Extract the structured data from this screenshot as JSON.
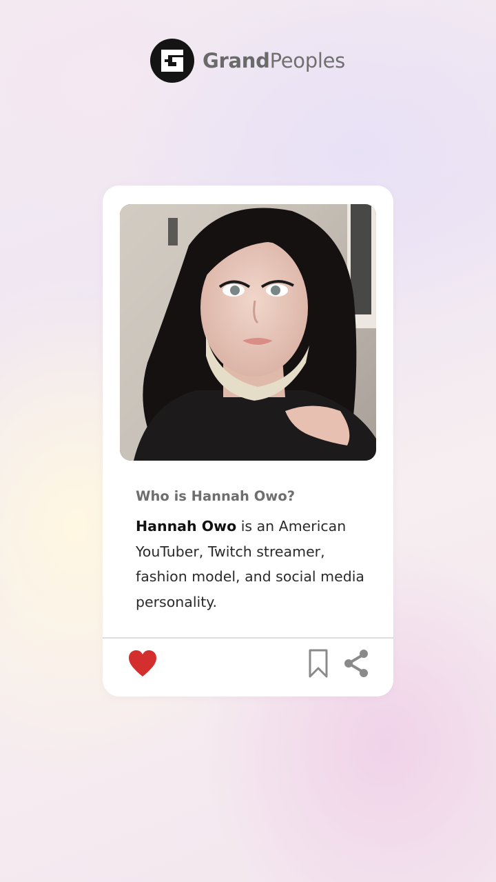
{
  "brand": {
    "name_bold": "Grand",
    "name_regular": "Peoples",
    "logo_icon": "grandpeoples-g-logo"
  },
  "post": {
    "image_alt": "Hannah Owo",
    "question": "Who is Hannah Owo?",
    "bio_name": "Hannah Owo",
    "bio_text": " is an American YouTuber, Twitch streamer, fashion model, and social media personality."
  },
  "actions": {
    "like_icon": "heart-icon",
    "save_icon": "bookmark-icon",
    "share_icon": "share-icon"
  },
  "colors": {
    "heart": "#d32f2f",
    "icon_gray": "#8a8a8a",
    "logo_bg": "#141414",
    "card_bg": "#ffffff"
  }
}
